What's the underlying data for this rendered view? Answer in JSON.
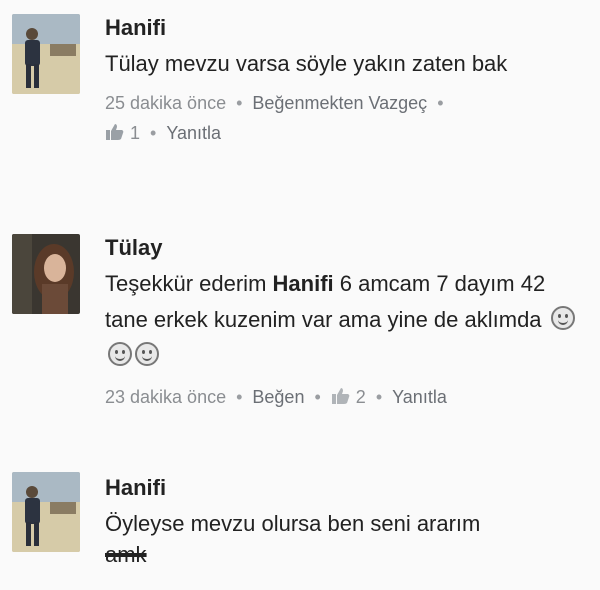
{
  "comments": [
    {
      "author": "Hanifi",
      "text": "Tülay mevzu varsa söyle yakın zaten bak",
      "time": "25 dakika önce",
      "action": "Beğenmekten Vazgeç",
      "like_count": "1",
      "reply": "Yanıtla"
    },
    {
      "author": "Tülay",
      "text_pre": "Teşekkür ederim ",
      "text_mention": "Hanifi",
      "text_post": " 6 amcam 7 dayım 42 tane erkek kuzenim var ama yine de aklımda",
      "time": "23 dakika önce",
      "action": "Beğen",
      "like_count": "2",
      "reply": "Yanıtla"
    },
    {
      "author": "Hanifi",
      "text": "Öyleyse mevzu olursa ben seni ararım",
      "cut_text": "amk"
    }
  ],
  "icons": {
    "like": "thumbs-up-icon",
    "emoji": "smiley-icon"
  }
}
